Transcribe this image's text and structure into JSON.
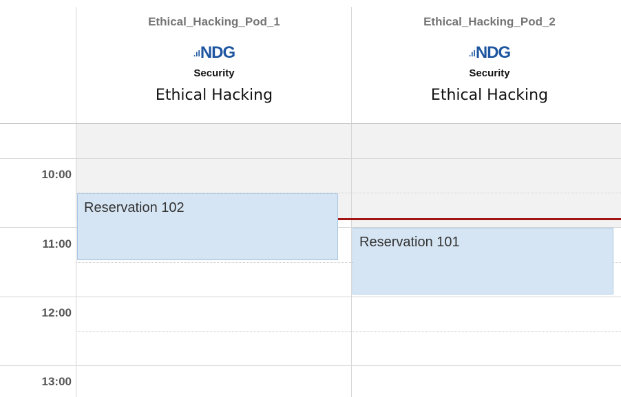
{
  "columns": [
    {
      "pod_name": "Ethical_Hacking_Pod_1",
      "logo_text": "NDG",
      "logo_bars": ".ıl",
      "category": "Security",
      "course": "Ethical Hacking"
    },
    {
      "pod_name": "Ethical_Hacking_Pod_2",
      "logo_text": "NDG",
      "logo_bars": ".ıl",
      "category": "Security",
      "course": "Ethical Hacking"
    }
  ],
  "times": [
    "10:00",
    "11:00",
    "12:00",
    "13:00"
  ],
  "reservations": [
    {
      "label": "Reservation 102",
      "pod": "Ethical_Hacking_Pod_1",
      "start": "10:30",
      "end": "11:30"
    },
    {
      "label": "Reservation 101",
      "pod": "Ethical_Hacking_Pod_2",
      "start": "11:00",
      "end": "12:00"
    }
  ],
  "current_time_indicator_color": "#a31616",
  "past_time_shading_color": "#f2f2f2"
}
